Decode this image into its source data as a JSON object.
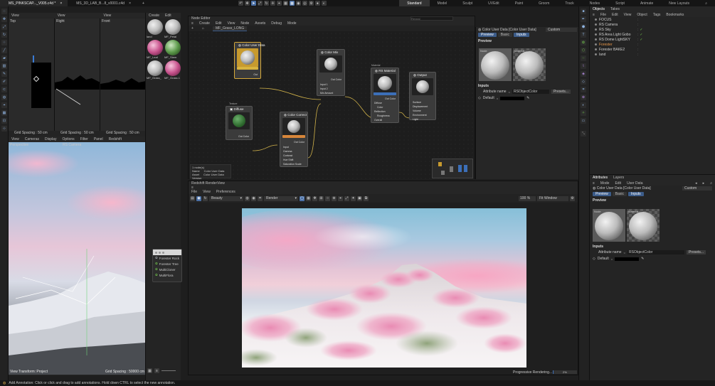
{
  "titlebar": {
    "tabs": [
      "MS_PINKSCAP..._V005.c4d *",
      "MS_3D_LAB_B...8_v0001.c4d"
    ],
    "layouts": [
      "Standard",
      "Model",
      "Sculpt",
      "UVEdit",
      "Paint",
      "Groom",
      "Track",
      "Nodes",
      "Script",
      "Animate",
      "New Layouts"
    ]
  },
  "viewports": {
    "top_menu": [
      "View"
    ],
    "labels": [
      "Top",
      "Right",
      "Front"
    ],
    "grid": "Grid Spacing : 50 cm",
    "persp_menu": [
      "View",
      "Cameras",
      "Display",
      "Options",
      "Filter",
      "Panel",
      "Redshift"
    ],
    "persp_label": "Perspective",
    "persp_camera": "RS Camera",
    "view_transform": "View Transform: Project",
    "grid_persp": "Grid Spacing : 50000 cm"
  },
  "material_manager": {
    "menu": [
      "Create",
      "Edit"
    ],
    "materials": [
      {
        "name": "land",
        "type": "grey"
      },
      {
        "name": "MF_Petal",
        "type": "grey"
      },
      {
        "name": "MF_Leaf",
        "type": "pink"
      },
      {
        "name": "MF_Stem",
        "type": "green"
      },
      {
        "name": "MF_Grass_",
        "type": "grey"
      },
      {
        "name": "MF_Grass.1",
        "type": "pink"
      }
    ]
  },
  "node_editor": {
    "title": "Node Editor",
    "menu": [
      "Create",
      "Edit",
      "View",
      "Node",
      "Assets",
      "Debug",
      "Mode"
    ],
    "tab": "MF_Grass_LONG",
    "search_placeholder": "Reveal",
    "nodes": {
      "color_user_data": {
        "title": "Color User Data",
        "out": "Out"
      },
      "color_mix": {
        "title": "Color Mix",
        "ports": [
          "Input 1",
          "Input 2",
          "Mix Amount"
        ],
        "out": "Out Color"
      },
      "rs_material": {
        "title": "RS Material",
        "sub": "Material",
        "out": "Out Color",
        "ports": [
          "Diffuse",
          "Color",
          "Reflection",
          "Roughness",
          "Overall"
        ]
      },
      "output": {
        "title": "Output",
        "ports": [
          "Surface",
          "Displacement",
          "Volume",
          "Environment",
          "Light"
        ]
      },
      "diffuse": {
        "title": "Diffuse",
        "sub": "Texture",
        "out": "Out Color"
      },
      "color_correct": {
        "title": "Color Correct",
        "out": "Out Color",
        "ports": [
          "Input",
          "Gamma",
          "Contrast",
          "Hue Shift",
          "Saturation Scale"
        ]
      }
    },
    "info": {
      "line1": "1 node(s)",
      "name_k": "Name",
      "name_v": "Color User Data",
      "asset_k": "Asset",
      "asset_v": "Color User Data",
      "version": "Version"
    }
  },
  "node_attr": {
    "title": "Color User Data [Color User Data]",
    "mode": "Custom",
    "tabs": [
      "Preview",
      "Basic",
      "Inputs"
    ],
    "preview_label": "Preview",
    "node_label": "Node",
    "material_label": "Material",
    "inputs_label": "Inputs",
    "attr_name_label": "Attribute name",
    "attr_name_value": "RSObjectColor",
    "presets": "Presets...",
    "default_label": "Default"
  },
  "render_view": {
    "title": "Redshift RenderView",
    "menu": [
      "File",
      "View",
      "Preferences"
    ],
    "beauty": "Beauty",
    "render_target": "Render",
    "zoom": "100 %",
    "fit": "Fit Window",
    "status": "Progressive Rendering...",
    "progress_text": "2%",
    "progress": 0.02
  },
  "float_menu": {
    "items": [
      "Forester Rock",
      "Forester Tree",
      "MultiCloner",
      "MultiFlora"
    ]
  },
  "objects": {
    "tabs": [
      "Objects",
      "Takes"
    ],
    "menu": [
      "File",
      "Edit",
      "View",
      "Object",
      "Tags",
      "Bookmarks"
    ],
    "items": [
      {
        "name": "FOCUS",
        "color": "#cfcfcf",
        "check": false
      },
      {
        "name": "RS Camera",
        "color": "#cfcfcf",
        "check": false
      },
      {
        "name": "RS Sky",
        "color": "#cfcfcf",
        "check": true
      },
      {
        "name": "RS Area Light Gobo",
        "color": "#cfcfcf",
        "check": true
      },
      {
        "name": "RS Dome LightSKY",
        "color": "#cfcfcf",
        "check": true
      },
      {
        "name": "Forester",
        "color": "#e8974a",
        "check": false
      },
      {
        "name": "Forester BAKE2",
        "color": "#cfcfcf",
        "check": false
      },
      {
        "name": "land",
        "color": "#cfcfcf",
        "check": false
      }
    ]
  },
  "attributes": {
    "tabs": [
      "Attributes",
      "Layers"
    ],
    "menu": [
      "Mode",
      "Edit",
      "User Data"
    ],
    "title": "Color User Data [Color User Data]",
    "mode": "Custom",
    "subtabs": [
      "Preview",
      "Basic",
      "Inputs"
    ],
    "preview_label": "Preview",
    "node_label": "Node",
    "material_label": "Material",
    "inputs_label": "Inputs",
    "attr_name_label": "Attribute name",
    "attr_name_value": "RSObjectColor",
    "presets": "Presets...",
    "default_label": "Default"
  },
  "statusbar": {
    "text": "Add Annotation: Click or click and drag to add annotations. Hold down CTRL to select the new annotation."
  },
  "colors": {
    "accent": "#3c5c8a",
    "node_selected": "#d6a93a",
    "wire": "#d2b34a",
    "pink_sky": "#f0a9c6"
  }
}
